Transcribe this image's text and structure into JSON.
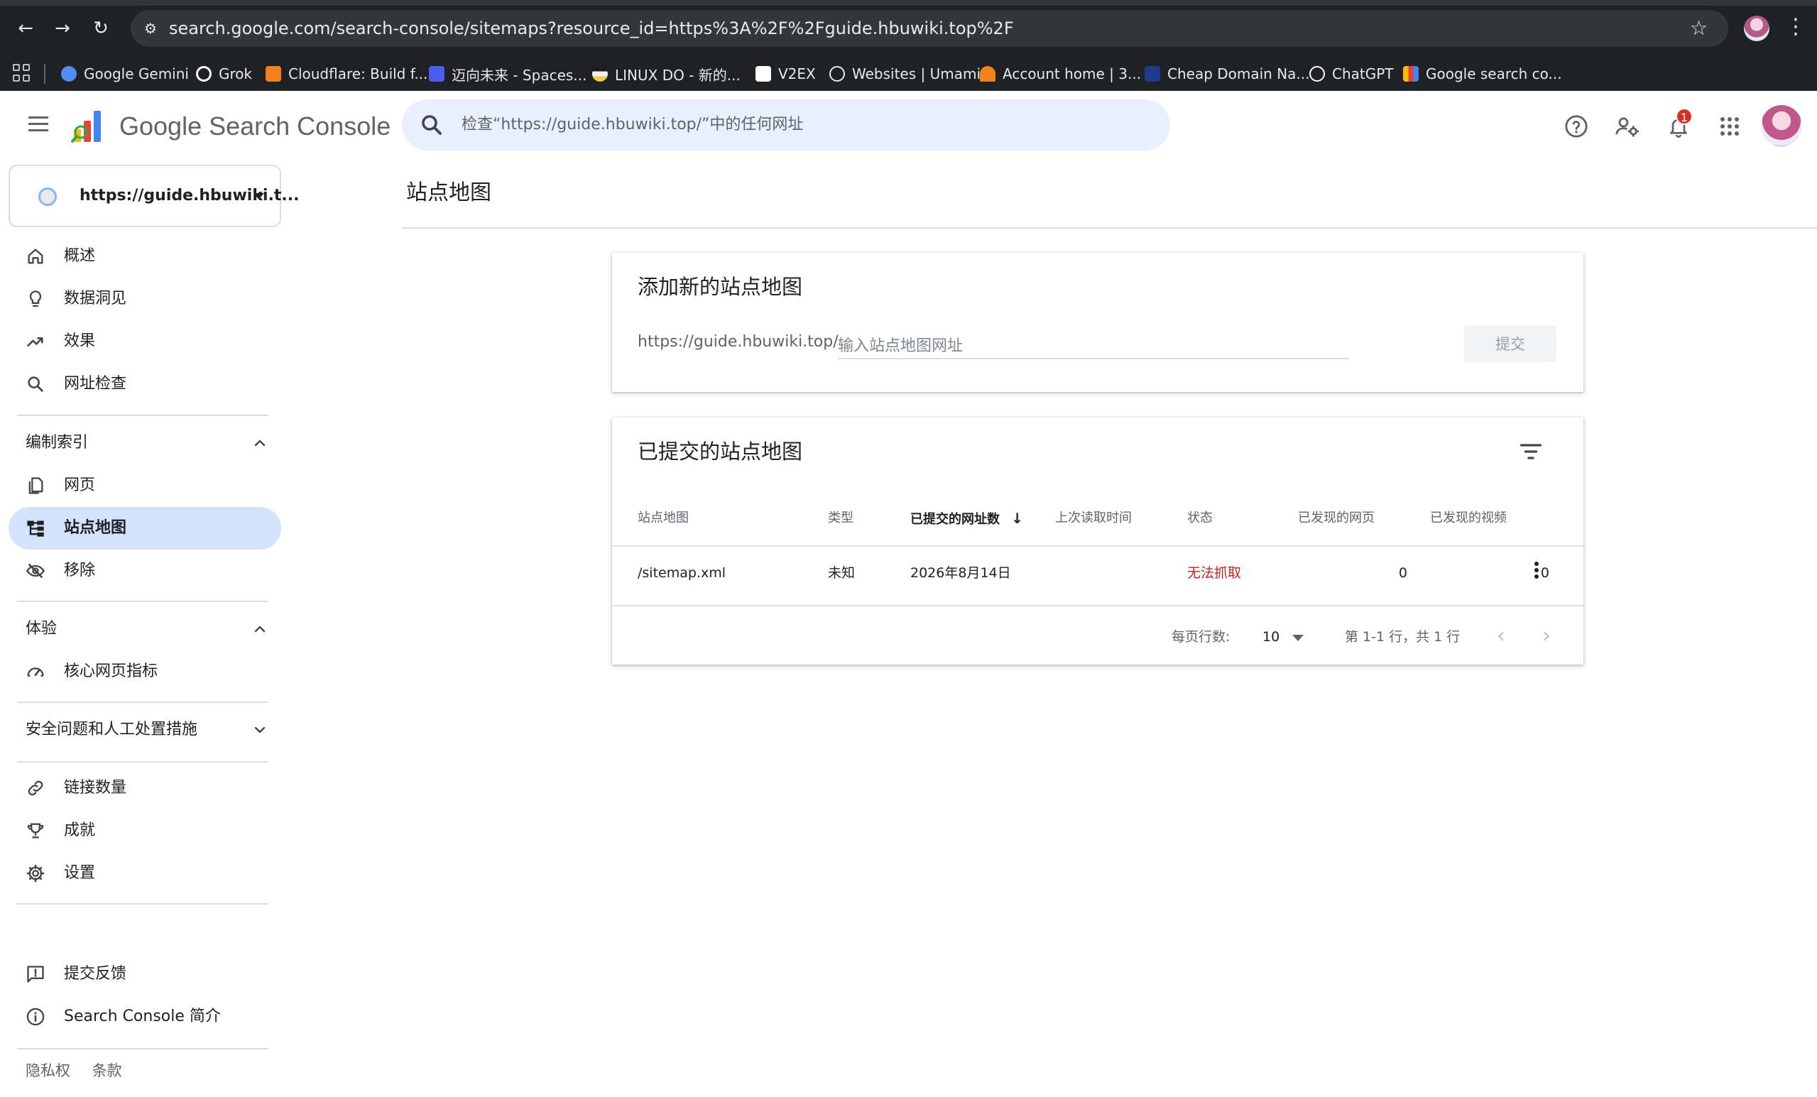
{
  "browser": {
    "url": "search.google.com/search-console/sitemaps?resource_id=https%3A%2F%2Fguide.hbuwiki.top%2F",
    "bookmarks": [
      {
        "label": "Google Gemini",
        "color": "#4f8df5"
      },
      {
        "label": "Grok",
        "color": "#ffffff"
      },
      {
        "label": "Cloudflare: Build f...",
        "color": "#f38020"
      },
      {
        "label": "迈向未来 - Spaces...",
        "color": "#4b5cf0"
      },
      {
        "label": "LINUX DO - 新的...",
        "color": "#f2c94c"
      },
      {
        "label": "V2EX",
        "color": "#ffffff"
      },
      {
        "label": "Websites | Umami",
        "color": "#202124"
      },
      {
        "label": "Account home | 3...",
        "color": "#f6821f"
      },
      {
        "label": "Cheap Domain Na...",
        "color": "#1e3a8a"
      },
      {
        "label": "ChatGPT",
        "color": "#ffffff"
      },
      {
        "label": "Google search co...",
        "color": "#fbbc04"
      }
    ]
  },
  "app": {
    "name": "Google Search Console",
    "search_placeholder": "检查“https://guide.hbuwiki.top/”中的任何网址",
    "notification_count": "1"
  },
  "property": {
    "label": "https://guide.hbuwiki.t..."
  },
  "sidebar": {
    "top_items": [
      {
        "label": "概述",
        "icon": "home-icon"
      },
      {
        "label": "数据洞见",
        "icon": "lightbulb-icon"
      },
      {
        "label": "效果",
        "icon": "trending-up-icon"
      },
      {
        "label": "网址检查",
        "icon": "search-icon"
      }
    ],
    "indexing": {
      "heading": "编制索引",
      "items": [
        {
          "label": "网页",
          "icon": "pages-icon"
        },
        {
          "label": "站点地图",
          "icon": "sitemap-icon",
          "active": true
        },
        {
          "label": "移除",
          "icon": "visibility-off-icon"
        }
      ]
    },
    "experience": {
      "heading": "体验",
      "items": [
        {
          "label": "核心网页指标",
          "icon": "speed-icon"
        }
      ]
    },
    "security": {
      "heading": "安全问题和人工处置措施"
    },
    "more_items": [
      {
        "label": "链接数量",
        "icon": "link-icon"
      },
      {
        "label": "成就",
        "icon": "trophy-icon"
      },
      {
        "label": "设置",
        "icon": "gear-icon"
      }
    ],
    "bottom_items": [
      {
        "label": "提交反馈",
        "icon": "feedback-icon"
      },
      {
        "label": "Search Console 简介",
        "icon": "info-icon"
      }
    ],
    "footer": {
      "privacy": "隐私权",
      "terms": "条款"
    }
  },
  "main": {
    "page_title": "站点地图",
    "add_card": {
      "title": "添加新的站点地图",
      "prefix": "https://guide.hbuwiki.top/",
      "input_placeholder": "输入站点地图网址",
      "input_value": "",
      "submit_label": "提交"
    },
    "submitted_card": {
      "title": "已提交的站点地图",
      "columns": [
        "站点地图",
        "类型",
        "已提交的网址数",
        "上次读取时间",
        "状态",
        "已发现的网页",
        "已发现的视频"
      ],
      "sort_arrow": "↓",
      "rows": [
        {
          "sitemap": "/sitemap.xml",
          "type": "未知",
          "submitted": "2026年8月14日",
          "last_read": "",
          "status": "无法抓取",
          "pages": "0",
          "videos": "0"
        }
      ],
      "pager": {
        "rows_per_page_label": "每页行数:",
        "rows_per_page": "10",
        "range_text": "第 1-1 行，共 1 行"
      }
    }
  }
}
